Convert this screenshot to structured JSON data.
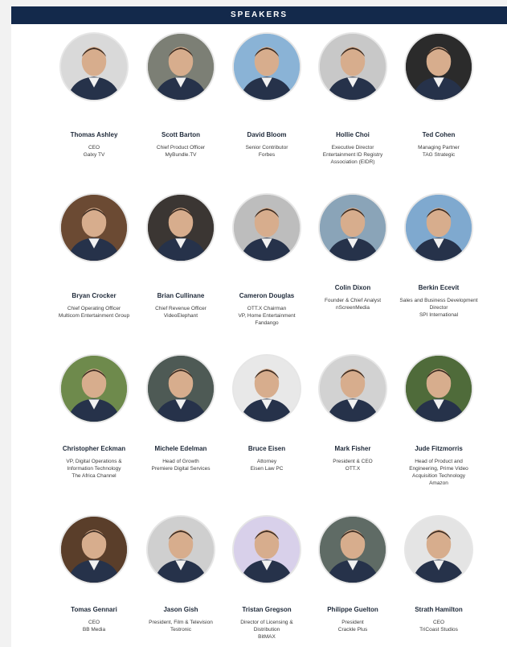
{
  "header": {
    "title": "SPEAKERS"
  },
  "colors": {
    "header_bg": "#13294b",
    "panel_bg": "#ffffff",
    "page_bg": "#f2f2f2"
  },
  "speakers": [
    {
      "name": "Thomas Ashley",
      "lines": [
        "CEO",
        "Galxy TV"
      ],
      "bg": "#d9d9d9"
    },
    {
      "name": "Scott Barton",
      "lines": [
        "Chief Product Officer",
        "MyBundle.TV"
      ],
      "bg": "#7c7f75"
    },
    {
      "name": "David Bloom",
      "lines": [
        "Senior Contributor",
        "Forbes"
      ],
      "bg": "#8ab3d6"
    },
    {
      "name": "Hollie Choi",
      "lines": [
        "Executive Director",
        "Entertainment ID Registry",
        "Association (EIDR)"
      ],
      "bg": "#c8c8c8"
    },
    {
      "name": "Ted Cohen",
      "lines": [
        "Managing Partner",
        "TAG Strategic"
      ],
      "bg": "#2b2b2b"
    },
    {
      "name": "Bryan Crocker",
      "lines": [
        "Chief Operating Officer",
        "Multicom Entertainment Group"
      ],
      "bg": "#6b4a33"
    },
    {
      "name": "Brian Cullinane",
      "lines": [
        "Chief Revenue Officer",
        "VideoElephant"
      ],
      "bg": "#3b3633"
    },
    {
      "name": "Cameron Douglas",
      "lines": [
        "OTT.X Chairman",
        "VP, Home Entertainment",
        "Fandango"
      ],
      "bg": "#bdbdbd"
    },
    {
      "name": "Colin Dixon",
      "lines": [
        "Founder & Chief Analyst",
        "nScreenMedia"
      ],
      "bg": "#8aa4b8"
    },
    {
      "name": "Berkin Ecevit",
      "lines": [
        "Sales and Business Development",
        "Director",
        "SPI International"
      ],
      "bg": "#7fa9cf"
    },
    {
      "name": "Christopher Eckman",
      "lines": [
        "VP, Digital Operations &",
        "Information Technology",
        "The Africa Channel"
      ],
      "bg": "#6e8a4c"
    },
    {
      "name": "Michele Edelman",
      "lines": [
        "Head of Growth",
        "Premiere Digital Services"
      ],
      "bg": "#4e5a55"
    },
    {
      "name": "Bruce Eisen",
      "lines": [
        "Attorney",
        "Eisen Law PC"
      ],
      "bg": "#e8e8e8"
    },
    {
      "name": "Mark Fisher",
      "lines": [
        "President & CEO",
        "OTT.X"
      ],
      "bg": "#d2d2d2"
    },
    {
      "name": "Jude Fitzmorris",
      "lines": [
        "Head of Product and",
        "Engineering, Prime Video",
        "Acquisition Technology",
        "Amazon"
      ],
      "bg": "#4f6b3a"
    },
    {
      "name": "Tomas Gennari",
      "lines": [
        "CEO",
        "BB Media"
      ],
      "bg": "#5a3e2a"
    },
    {
      "name": "Jason Gish",
      "lines": [
        "President, Film & Television",
        "Testronic"
      ],
      "bg": "#cfcfcf"
    },
    {
      "name": "Tristan Gregson",
      "lines": [
        "Director of Licensing &",
        "Distribution",
        "BitMAX"
      ],
      "bg": "#d8d0ea"
    },
    {
      "name": "Philippe Guelton",
      "lines": [
        "President",
        "Crackle Plus"
      ],
      "bg": "#5f6b65"
    },
    {
      "name": "Strath Hamilton",
      "lines": [
        "CEO",
        "TriCoast Studios"
      ],
      "bg": "#e4e4e4"
    }
  ]
}
